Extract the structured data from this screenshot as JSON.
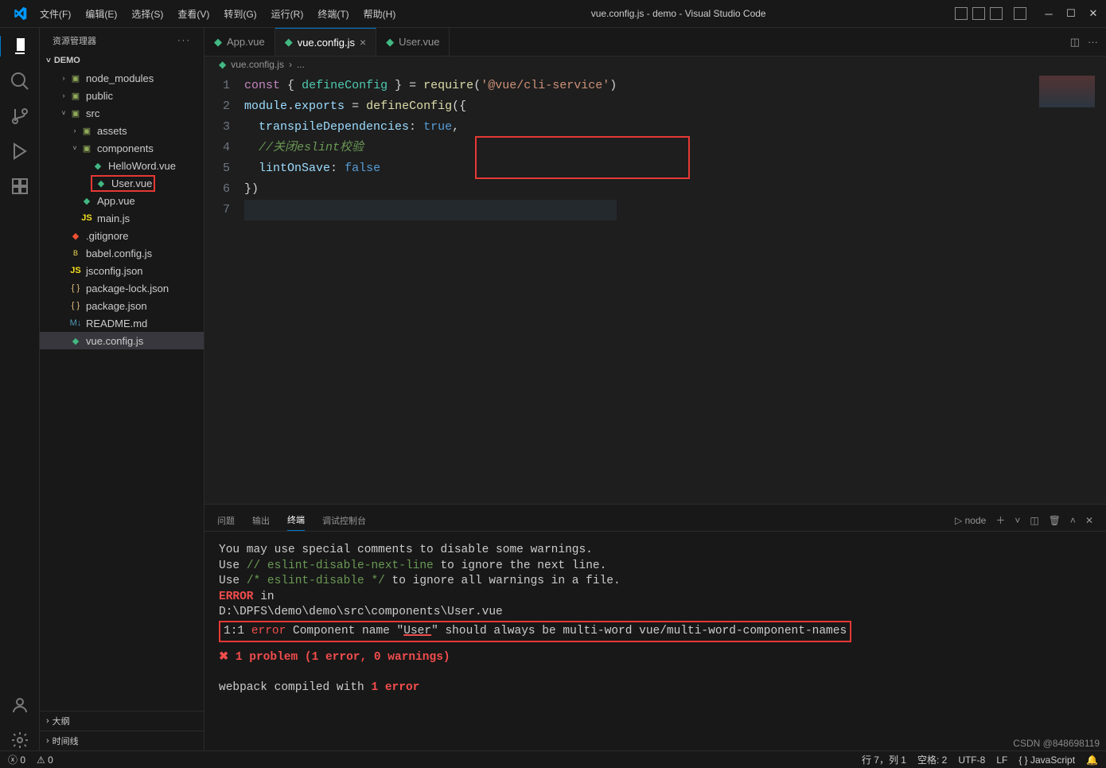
{
  "title": "vue.config.js - demo - Visual Studio Code",
  "menubar": [
    "文件(F)",
    "编辑(E)",
    "选择(S)",
    "查看(V)",
    "转到(G)",
    "运行(R)",
    "终端(T)",
    "帮助(H)"
  ],
  "sidebar": {
    "title": "资源管理器",
    "root": "DEMO",
    "tree": [
      {
        "label": "node_modules",
        "indent": 1,
        "chev": "›",
        "icon": "folder"
      },
      {
        "label": "public",
        "indent": 1,
        "chev": "›",
        "icon": "folder"
      },
      {
        "label": "src",
        "indent": 1,
        "chev": "˅",
        "icon": "folder"
      },
      {
        "label": "assets",
        "indent": 2,
        "chev": "›",
        "icon": "folder"
      },
      {
        "label": "components",
        "indent": 2,
        "chev": "˅",
        "icon": "folder"
      },
      {
        "label": "HelloWord.vue",
        "indent": 3,
        "chev": "",
        "icon": "vue"
      },
      {
        "label": "User.vue",
        "indent": 3,
        "chev": "",
        "icon": "vue",
        "annot": true
      },
      {
        "label": "App.vue",
        "indent": 2,
        "chev": "",
        "icon": "vue"
      },
      {
        "label": "main.js",
        "indent": 2,
        "chev": "",
        "icon": "js"
      },
      {
        "label": ".gitignore",
        "indent": 1,
        "chev": "",
        "icon": "git"
      },
      {
        "label": "babel.config.js",
        "indent": 1,
        "chev": "",
        "icon": "babel"
      },
      {
        "label": "jsconfig.json",
        "indent": 1,
        "chev": "",
        "icon": "js"
      },
      {
        "label": "package-lock.json",
        "indent": 1,
        "chev": "",
        "icon": "json"
      },
      {
        "label": "package.json",
        "indent": 1,
        "chev": "",
        "icon": "json"
      },
      {
        "label": "README.md",
        "indent": 1,
        "chev": "",
        "icon": "md"
      },
      {
        "label": "vue.config.js",
        "indent": 1,
        "chev": "",
        "icon": "vue",
        "selected": true
      }
    ],
    "outline": "大纲",
    "timeline": "时间线"
  },
  "tabs": [
    {
      "label": "App.vue",
      "active": false
    },
    {
      "label": "vue.config.js",
      "active": true,
      "dirty": false
    },
    {
      "label": "User.vue",
      "active": false
    }
  ],
  "breadcrumb": {
    "file": "vue.config.js",
    "sep": "›",
    "dots": "..."
  },
  "editor": {
    "lines": [
      {
        "n": 1,
        "html": "<span class='c-keyword'>const</span> <span class='c-op'>{</span> <span class='c-type'>defineConfig</span> <span class='c-op'>}</span> <span class='c-op'>=</span> <span class='c-func'>require</span><span class='c-op'>(</span><span class='c-string'>'@vue/cli-service'</span><span class='c-op'>)</span>"
      },
      {
        "n": 2,
        "html": "<span class='c-var'>module</span><span class='c-op'>.</span><span class='c-var'>exports</span> <span class='c-op'>=</span> <span class='c-func'>defineConfig</span><span class='c-op'>({</span>"
      },
      {
        "n": 3,
        "html": "  <span class='c-var'>transpileDependencies</span><span class='c-op'>:</span> <span class='c-const'>true</span><span class='c-op'>,</span>"
      },
      {
        "n": 4,
        "html": "  <span class='c-comment'>//关闭eslint校验</span>"
      },
      {
        "n": 5,
        "html": "  <span class='c-var'>lintOnSave</span><span class='c-op'>:</span> <span class='c-const'>false</span>"
      },
      {
        "n": 6,
        "html": "<span class='c-op'>})</span>"
      },
      {
        "n": 7,
        "html": "",
        "current": true
      }
    ]
  },
  "panel": {
    "tabs": [
      "问题",
      "输出",
      "终端",
      "调试控制台"
    ],
    "active": 2,
    "shell": "node",
    "terminal": {
      "l1": "You may use special comments to disable some warnings.",
      "l2a": "Use ",
      "l2b": "// eslint-disable-next-line",
      "l2c": " to ignore the next line.",
      "l3a": "Use ",
      "l3b": "/* eslint-disable */",
      "l3c": " to ignore all warnings in a file.",
      "l4a": "ERROR",
      "l4b": " in",
      "l5": "D:\\DPFS\\demo\\demo\\src\\components\\User.vue",
      "l6a": "  1:1  ",
      "l6b": "error",
      "l6c": "  Component name \"",
      "l6d": "User",
      "l6e": "\" should always be multi-word  vue/multi-word-component-names",
      "l7a": "✖ ",
      "l7b": "1 problem (1 error, 0 warnings)",
      "l8a": "webpack compiled with ",
      "l8b": "1 error"
    }
  },
  "statusbar": {
    "errors": "0",
    "warnings": "0",
    "pos": "行 7，列 1",
    "spaces": "空格: 2",
    "encoding": "UTF-8",
    "eol": "LF",
    "lang": "{ } JavaScript",
    "bell": "🔔"
  },
  "watermark": "CSDN @848698119"
}
